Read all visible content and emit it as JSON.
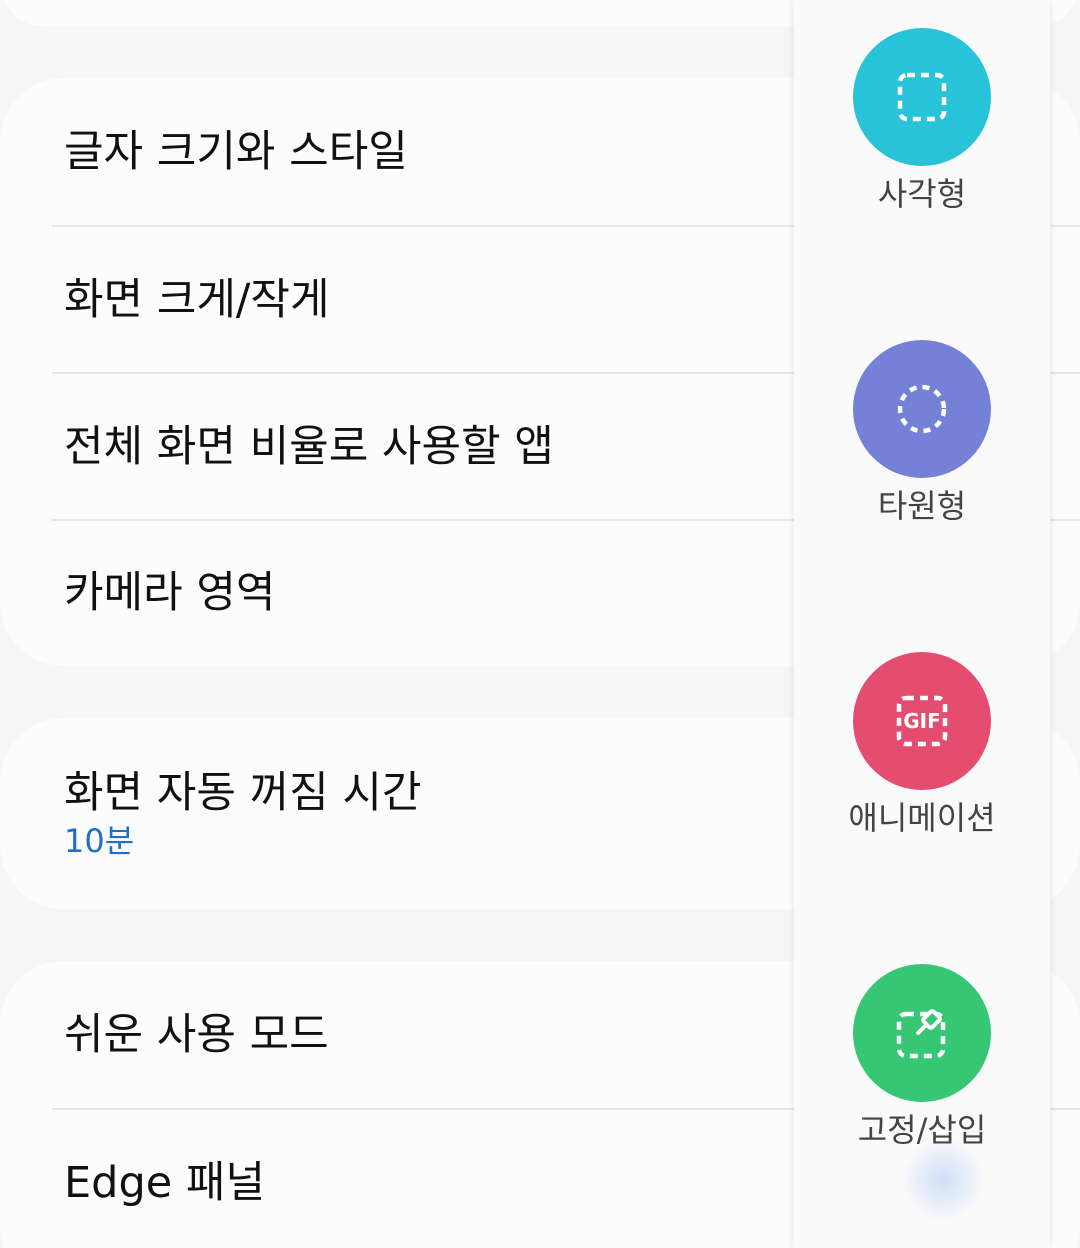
{
  "settings": {
    "display_group": {
      "items": [
        {
          "title": "글자 크기와 스타일"
        },
        {
          "title": "화면 크게/작게"
        },
        {
          "title": "전체 화면 비율로 사용할 앱"
        },
        {
          "title": "카메라 영역"
        }
      ]
    },
    "timeout": {
      "title": "화면 자동 꺼짐 시간",
      "value": "10분"
    },
    "easy_group": {
      "items": [
        {
          "title": "쉬운 사용 모드"
        },
        {
          "title": "Edge 패널"
        }
      ]
    }
  },
  "edge_panel": {
    "tools": [
      {
        "label": "사각형",
        "icon": "rectangle-select-icon",
        "color": "#28c2d9"
      },
      {
        "label": "타원형",
        "icon": "oval-select-icon",
        "color": "#7581d6"
      },
      {
        "label": "애니메이션",
        "icon": "gif-icon",
        "color": "#e44d6f",
        "icon_text": "GIF"
      },
      {
        "label": "고정/삽입",
        "icon": "pin-insert-icon",
        "color": "#37c774"
      }
    ]
  },
  "colors": {
    "background": "#f6f6f6",
    "card": "#fcfcfc",
    "accent_value": "#1a73c9"
  }
}
